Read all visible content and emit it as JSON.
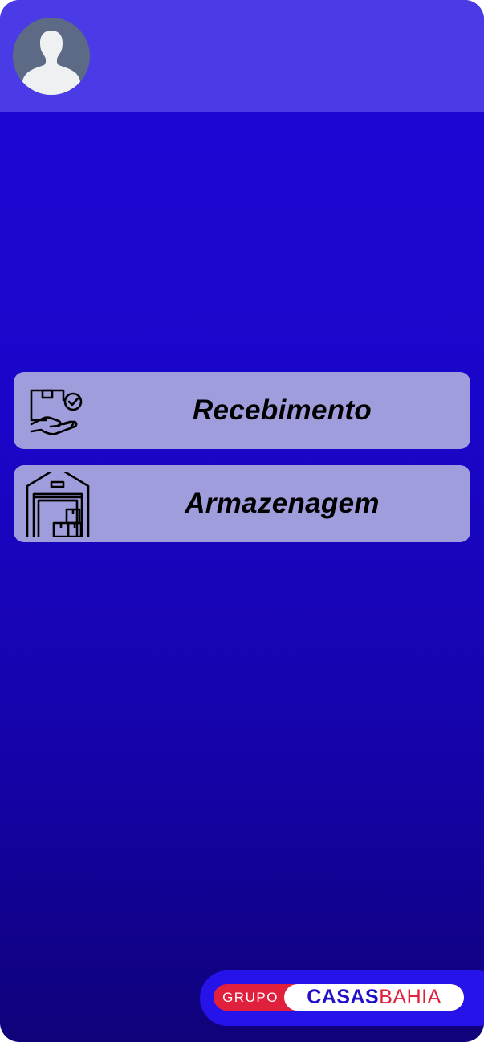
{
  "header": {
    "avatar_icon": "user-avatar-icon"
  },
  "menu": [
    {
      "label": "Recebimento",
      "icon": "package-received-icon"
    },
    {
      "label": "Armazenagem",
      "icon": "warehouse-icon"
    }
  ],
  "brand": {
    "grupo": "GRUPO",
    "casas": "CASAS",
    "bahia": "BAHIA"
  },
  "colors": {
    "header_bg": "#4b3be6",
    "app_bg_top": "#1d06d8",
    "app_bg_bottom": "#0f0279",
    "card_bg": "#9f9ddb",
    "brand_red": "#e0203d",
    "brand_blue": "#2210c8"
  }
}
